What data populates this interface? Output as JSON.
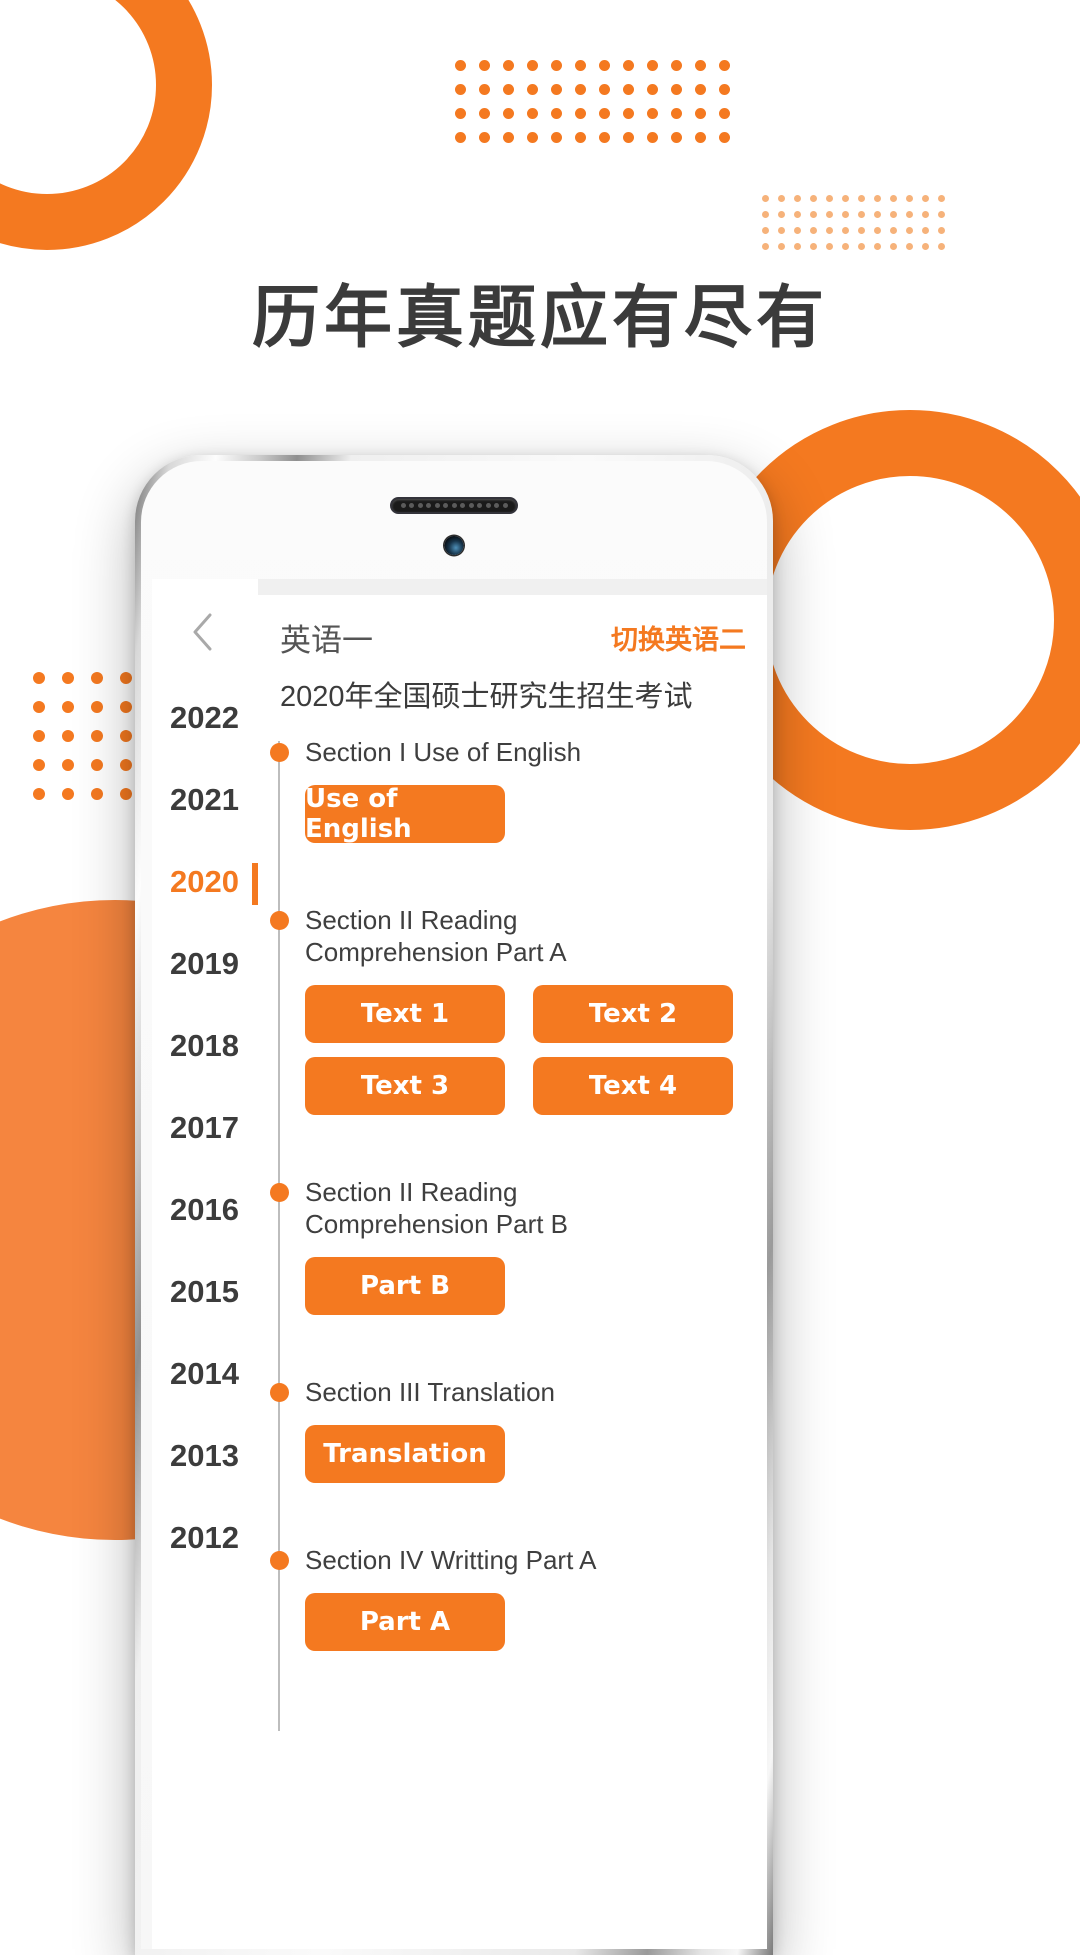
{
  "page": {
    "headline": "历年真题应有尽有",
    "accent_color": "#F47920",
    "accent_color_light": "#F5853F",
    "text_color": "#3b3b3b"
  },
  "phone": {
    "speaker_name": "earpiece-speaker",
    "camera_name": "front-camera"
  },
  "app": {
    "back_icon": "‹",
    "subject": "英语一",
    "switch_label": "切换英语二",
    "exam_title": "2020年全国硕士研究生招生考试",
    "years": [
      {
        "label": "2022",
        "active": false
      },
      {
        "label": "2021",
        "active": false
      },
      {
        "label": "2020",
        "active": true
      },
      {
        "label": "2019",
        "active": false
      },
      {
        "label": "2018",
        "active": false
      },
      {
        "label": "2017",
        "active": false
      },
      {
        "label": "2016",
        "active": false
      },
      {
        "label": "2015",
        "active": false
      },
      {
        "label": "2014",
        "active": false
      },
      {
        "label": "2013",
        "active": false
      },
      {
        "label": "2012",
        "active": false
      }
    ],
    "sections": [
      {
        "label": "Section I Use of English",
        "buttons": [
          "Use of English"
        ]
      },
      {
        "label": "Section II Reading Comprehension Part A",
        "buttons": [
          "Text 1",
          "Text 2",
          "Text 3",
          "Text 4"
        ]
      },
      {
        "label": "Section II Reading Comprehension Part B",
        "buttons": [
          "Part B"
        ]
      },
      {
        "label": "Section III Translation",
        "buttons": [
          "Translation"
        ]
      },
      {
        "label": "Section IV Writting Part A",
        "buttons": [
          "Part A"
        ]
      }
    ]
  },
  "decor": {
    "dot_grids": [
      {
        "name": "dot-grid-top",
        "cols": 12,
        "rows": 4,
        "dot": 11,
        "gap": 13,
        "color": "#F47920"
      },
      {
        "name": "dot-grid-right",
        "cols": 12,
        "rows": 4,
        "dot": 7,
        "gap": 9,
        "color": "#F6B27A"
      },
      {
        "name": "dot-grid-left",
        "cols": 7,
        "rows": 5,
        "dot": 12,
        "gap": 17,
        "color": "#F47920"
      }
    ]
  }
}
